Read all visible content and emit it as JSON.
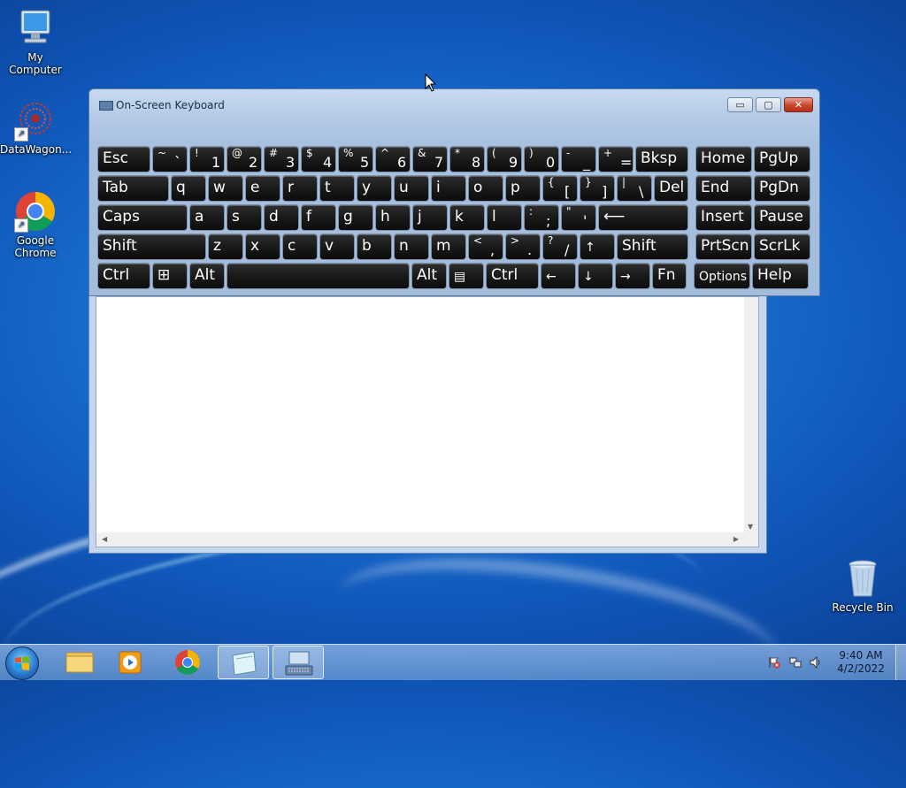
{
  "desktop": {
    "icons": [
      {
        "label": "My Computer"
      },
      {
        "label": "DataWagon..."
      },
      {
        "label": "Google Chrome"
      },
      {
        "label": "Recycle Bin"
      }
    ]
  },
  "osk": {
    "title": "On-Screen Keyboard",
    "buttons": {
      "minimize": "▭",
      "maximize": "▢",
      "close": "✕"
    },
    "rows": [
      [
        {
          "main": "Esc",
          "w": 60
        },
        {
          "shift": "~",
          "base": "`",
          "w": 40
        },
        {
          "shift": "!",
          "base": "1",
          "w": 40
        },
        {
          "shift": "@",
          "base": "2",
          "w": 40
        },
        {
          "shift": "#",
          "base": "3",
          "w": 40
        },
        {
          "shift": "$",
          "base": "4",
          "w": 40
        },
        {
          "shift": "%",
          "base": "5",
          "w": 40
        },
        {
          "shift": "^",
          "base": "6",
          "w": 40
        },
        {
          "shift": "&",
          "base": "7",
          "w": 40
        },
        {
          "shift": "*",
          "base": "8",
          "w": 40
        },
        {
          "shift": "(",
          "base": "9",
          "w": 40
        },
        {
          "shift": ")",
          "base": "0",
          "w": 40
        },
        {
          "shift": "-",
          "base": "_",
          "w": 40
        },
        {
          "shift": "+",
          "base": "=",
          "w": 40
        },
        {
          "main": "Bksp",
          "w": 60,
          "gapAfter": 6
        },
        {
          "main": "Home",
          "w": 64
        },
        {
          "main": "PgUp",
          "w": 64
        }
      ],
      [
        {
          "main": "Tab",
          "w": 81
        },
        {
          "main": "q",
          "w": 40
        },
        {
          "main": "w",
          "w": 40
        },
        {
          "main": "e",
          "w": 40
        },
        {
          "main": "r",
          "w": 40
        },
        {
          "main": "t",
          "w": 40
        },
        {
          "main": "y",
          "w": 40
        },
        {
          "main": "u",
          "w": 40
        },
        {
          "main": "i",
          "w": 40
        },
        {
          "main": "o",
          "w": 40
        },
        {
          "main": "p",
          "w": 40
        },
        {
          "shift": "{",
          "base": "[",
          "w": 40
        },
        {
          "shift": "}",
          "base": "]",
          "w": 40
        },
        {
          "shift": "|",
          "base": "\\",
          "w": 40
        },
        {
          "main": "Del",
          "w": 39,
          "gapAfter": 6
        },
        {
          "main": "End",
          "w": 64
        },
        {
          "main": "PgDn",
          "w": 64
        }
      ],
      [
        {
          "main": "Caps",
          "w": 102
        },
        {
          "main": "a",
          "w": 40
        },
        {
          "main": "s",
          "w": 40
        },
        {
          "main": "d",
          "w": 40
        },
        {
          "main": "f",
          "w": 40
        },
        {
          "main": "g",
          "w": 40
        },
        {
          "main": "h",
          "w": 40
        },
        {
          "main": "j",
          "w": 40
        },
        {
          "main": "k",
          "w": 40
        },
        {
          "main": "l",
          "w": 40
        },
        {
          "shift": ":",
          "base": ";",
          "w": 40
        },
        {
          "shift": "\"",
          "base": "'",
          "w": 40
        },
        {
          "main": "⟵",
          "w": 102,
          "gapAfter": 6
        },
        {
          "main": "Insert",
          "w": 64
        },
        {
          "main": "Pause",
          "w": 64
        }
      ],
      [
        {
          "main": "Shift",
          "w": 123
        },
        {
          "main": "z",
          "w": 40
        },
        {
          "main": "x",
          "w": 40
        },
        {
          "main": "c",
          "w": 40
        },
        {
          "main": "v",
          "w": 40
        },
        {
          "main": "b",
          "w": 40
        },
        {
          "main": "n",
          "w": 40
        },
        {
          "main": "m",
          "w": 40
        },
        {
          "shift": "<",
          "base": ",",
          "w": 40
        },
        {
          "shift": ">",
          "base": ".",
          "w": 40
        },
        {
          "shift": "?",
          "base": "/",
          "w": 40
        },
        {
          "main": "↑",
          "w": 40,
          "small": true
        },
        {
          "main": "Shift",
          "w": 81,
          "gapAfter": 6
        },
        {
          "main": "PrtScn",
          "w": 64
        },
        {
          "main": "ScrLk",
          "w": 64
        }
      ],
      [
        {
          "main": "Ctrl",
          "w": 60
        },
        {
          "main": "⊞",
          "w": 40
        },
        {
          "main": "Alt",
          "w": 40
        },
        {
          "main": "",
          "w": 207
        },
        {
          "main": "Alt",
          "w": 40
        },
        {
          "main": "▤",
          "w": 40,
          "small": true
        },
        {
          "main": "Ctrl",
          "w": 60
        },
        {
          "main": "←",
          "w": 40,
          "small": true
        },
        {
          "main": "↓",
          "w": 40,
          "small": true
        },
        {
          "main": "→",
          "w": 40,
          "small": true
        },
        {
          "main": "Fn",
          "w": 39,
          "gapAfter": 6
        },
        {
          "main": "Options",
          "w": 64,
          "small": true
        },
        {
          "main": "Help",
          "w": 64
        }
      ]
    ]
  },
  "taskbar": {
    "clock_time": "9:40 AM",
    "clock_date": "4/2/2022"
  }
}
